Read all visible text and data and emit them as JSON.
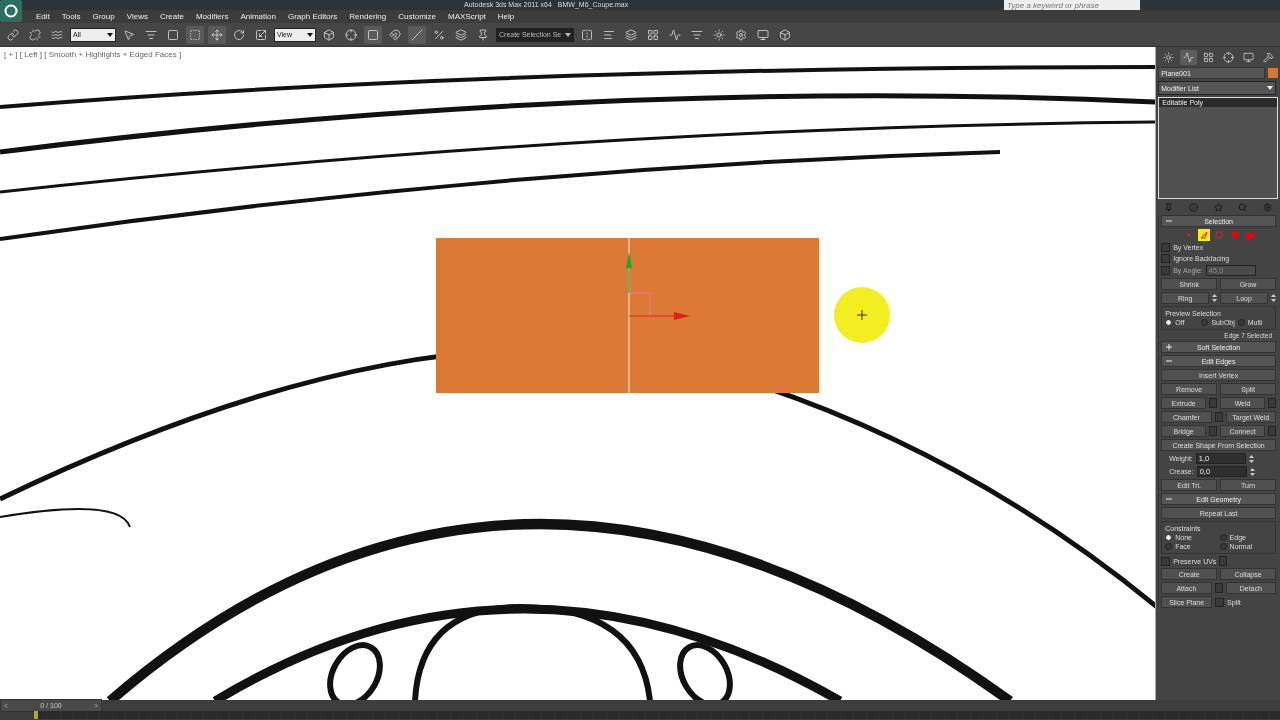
{
  "title_bar": {
    "title": "Autodesk 3ds Max 2011 x64",
    "file": "BMW_M6_Coupe.max",
    "search": {
      "placeholder": "Type a keyword or phrase"
    }
  },
  "menu": [
    "Edit",
    "Tools",
    "Group",
    "Views",
    "Create",
    "Modifiers",
    "Animation",
    "Graph Editors",
    "Rendering",
    "Customize",
    "MAXScript",
    "Help"
  ],
  "toolbar": {
    "selection_filter": "All",
    "reference_coord": "View",
    "named_selection": {
      "placeholder": "Create Selection Se"
    }
  },
  "viewport": {
    "label": "[ + ] [ Left ] [ Smooth + Highlights + Edged Faces ]"
  },
  "command_panel": {
    "tabs": [
      {
        "kind": "create",
        "selected": false
      },
      {
        "kind": "modify",
        "selected": true
      },
      {
        "kind": "hierarchy",
        "selected": false
      },
      {
        "kind": "motion",
        "selected": false
      },
      {
        "kind": "display",
        "selected": false
      },
      {
        "kind": "utilities",
        "selected": false
      }
    ],
    "object_name": "Plane001",
    "modifier_list": "Modifier List",
    "stack": [
      {
        "label": "Editable Poly",
        "selected": true
      }
    ],
    "rollouts": [
      {
        "title": "Selection",
        "expanded": true,
        "rows": [
          {
            "kind": "subobjects",
            "items": [
              {
                "kind": "vertex",
                "selected": false
              },
              {
                "kind": "edge",
                "selected": true
              },
              {
                "kind": "border",
                "selected": false
              },
              {
                "kind": "polygon",
                "selected": false
              },
              {
                "kind": "element",
                "selected": false
              }
            ]
          },
          {
            "kind": "checkbox",
            "label": "By Vertex",
            "checked": false
          },
          {
            "kind": "checkbox",
            "label": "Ignore Backfacing",
            "checked": false
          },
          {
            "kind": "checkbox",
            "label": "By Angle:",
            "checked": false,
            "value": "45,0",
            "disabled": true
          },
          {
            "kind": "buttons",
            "items": [
              {
                "label": "Shrink"
              },
              {
                "label": "Grow"
              }
            ]
          },
          {
            "kind": "buttons",
            "items": [
              {
                "label": "Ring",
                "spinner": true
              },
              {
                "label": "Loop",
                "spinner": true
              }
            ]
          },
          {
            "kind": "radios",
            "group": "Preview Selection",
            "items": [
              {
                "label": "Off",
                "selected": true
              },
              {
                "label": "SubObj",
                "selected": false
              },
              {
                "label": "Multi",
                "selected": false
              }
            ]
          },
          {
            "kind": "status",
            "text": "Edge 7 Selected"
          }
        ]
      },
      {
        "title": "Soft Selection",
        "expanded": false
      },
      {
        "title": "Edit Edges",
        "expanded": true,
        "rows": [
          {
            "kind": "buttons",
            "items": [
              {
                "label": "Insert Vertex"
              }
            ]
          },
          {
            "kind": "buttons",
            "items": [
              {
                "label": "Remove"
              },
              {
                "label": "Split"
              }
            ]
          },
          {
            "kind": "buttons",
            "items": [
              {
                "label": "Extrude",
                "settings": true
              },
              {
                "label": "Weld",
                "settings": true
              }
            ]
          },
          {
            "kind": "buttons",
            "items": [
              {
                "label": "Chamfer",
                "settings": true
              },
              {
                "label": "Target Weld"
              }
            ]
          },
          {
            "kind": "buttons",
            "items": [
              {
                "label": "Bridge",
                "settings": true
              },
              {
                "label": "Connect",
                "settings": true
              }
            ]
          },
          {
            "kind": "buttons",
            "items": [
              {
                "label": "Create Shape From Selection"
              }
            ]
          },
          {
            "kind": "spinner",
            "label": "Weight:",
            "value": "1,0"
          },
          {
            "kind": "spinner",
            "label": "Crease:",
            "value": "0,0"
          },
          {
            "kind": "buttons",
            "items": [
              {
                "label": "Edit Tri."
              },
              {
                "label": "Turn"
              }
            ]
          }
        ]
      },
      {
        "title": "Edit Geometry",
        "expanded": true,
        "rows": [
          {
            "kind": "buttons",
            "items": [
              {
                "label": "Repeat Last"
              }
            ]
          },
          {
            "kind": "radios",
            "group": "Constraints",
            "items": [
              {
                "label": "None",
                "selected": true
              },
              {
                "label": "Edge",
                "selected": false
              },
              {
                "label": "Face",
                "selected": false
              },
              {
                "label": "Normal",
                "selected": false
              }
            ]
          },
          {
            "kind": "checkbox",
            "label": "Preserve UVs",
            "checked": false,
            "settings": true
          },
          {
            "kind": "buttons",
            "items": [
              {
                "label": "Create"
              },
              {
                "label": "Collapse"
              }
            ]
          },
          {
            "kind": "buttons",
            "items": [
              {
                "label": "Attach",
                "settings": true
              },
              {
                "label": "Detach"
              }
            ]
          },
          {
            "kind": "slice",
            "button": "Slice Plane",
            "checkbox": {
              "label": "Split",
              "checked": false
            }
          }
        ]
      }
    ]
  },
  "time_slider": {
    "prev": "<",
    "frame": "0 / 100",
    "next": ">",
    "level": 0
  }
}
